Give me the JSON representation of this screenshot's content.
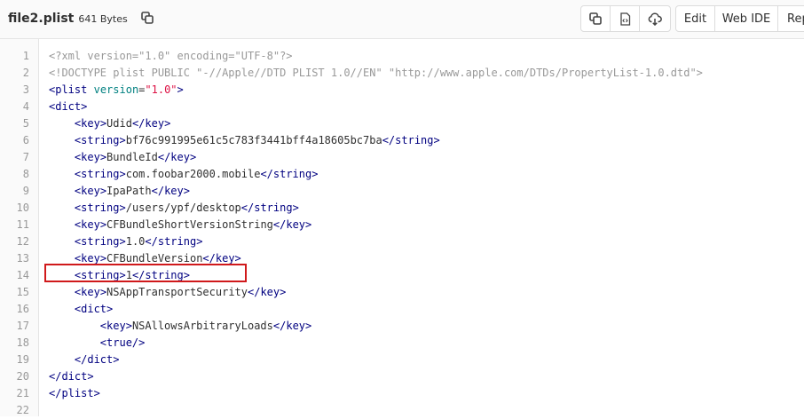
{
  "file": {
    "name": "file2.plist",
    "size": "641 Bytes"
  },
  "toolbar": {
    "edit_label": "Edit",
    "webide_label": "Web IDE",
    "replace_label": "Rep"
  },
  "icons": {
    "copy_file_path": "copy-icon",
    "copy_contents": "copy-icon",
    "raw": "file-code-icon",
    "download": "download-cloud-icon"
  },
  "highlight_color": "#d0191b",
  "code": {
    "line_numbers": [
      "1",
      "2",
      "3",
      "4",
      "5",
      "6",
      "7",
      "8",
      "9",
      "10",
      "11",
      "12",
      "13",
      "14",
      "15",
      "16",
      "17",
      "18",
      "19",
      "20",
      "21",
      "22"
    ],
    "lines": [
      "<?xml version=\"1.0\" encoding=\"UTF-8\"?>",
      "<!DOCTYPE plist PUBLIC \"-//Apple//DTD PLIST 1.0//EN\" \"http://www.apple.com/DTDs/PropertyList-1.0.dtd\">",
      "<plist version=\"1.0\">",
      "<dict>",
      "    <key>Udid</key>",
      "    <string>bf76c991995e61c5c783f3441bff4a18605bc7ba</string>",
      "    <key>BundleId</key>",
      "    <string>com.foobar2000.mobile</string>",
      "    <key>IpaPath</key>",
      "    <string>/users/ypf/desktop</string>",
      "    <key>CFBundleShortVersionString</key>",
      "    <string>1.0</string>",
      "    <key>CFBundleVersion</key>",
      "    <string>1</string>",
      "    <key>NSAppTransportSecurity</key>",
      "    <dict>",
      "        <key>NSAllowsArbitraryLoads</key>",
      "        <true/>",
      "    </dict>",
      "</dict>",
      "</plist>",
      ""
    ]
  }
}
